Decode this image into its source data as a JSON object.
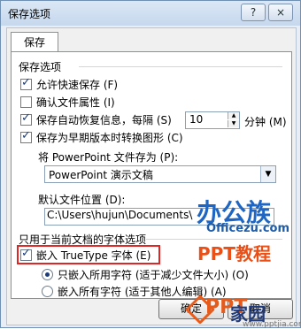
{
  "dialog": {
    "title": "保存选项",
    "help_button": "?",
    "close_button": "×",
    "tab_label": "保存",
    "save_options": {
      "section_label": "保存选项",
      "allow_fast_save": "允许快速保存 (F)",
      "confirm_properties": "确认文件属性 (I)",
      "autorecover_label": "保存自动恢复信息，每隔 (S)",
      "autorecover_value": "10",
      "autorecover_unit": "分钟 (M)",
      "save_earlier_graphics": "保存为早期版本时转换图形 (C)",
      "save_as_label": "将 PowerPoint 文件存为 (P):",
      "save_as_value": "PowerPoint 演示文稿",
      "default_location_label": "默认文件位置 (D):",
      "default_location_value": "C:\\Users\\hujun\\Documents\\"
    },
    "font_section": {
      "section_label": "只用于当前文档的字体选项",
      "embed_truetype": "嵌入 TrueType 字体 (E)",
      "embed_used_chars": "只嵌入所用字符 (适于减少文件大小) (O)",
      "embed_all_chars": "嵌入所有字符 (适于其他人编辑) (A)"
    },
    "buttons": {
      "ok": "确定",
      "cancel": "取消"
    },
    "watermark": {
      "brand": "办公族",
      "domain": "Officezu.com",
      "ppt_text": "PPT教程",
      "bottom_ppt": "PPT",
      "bottom_home": "家园",
      "bottom_url": "www.pptjia.com"
    }
  }
}
